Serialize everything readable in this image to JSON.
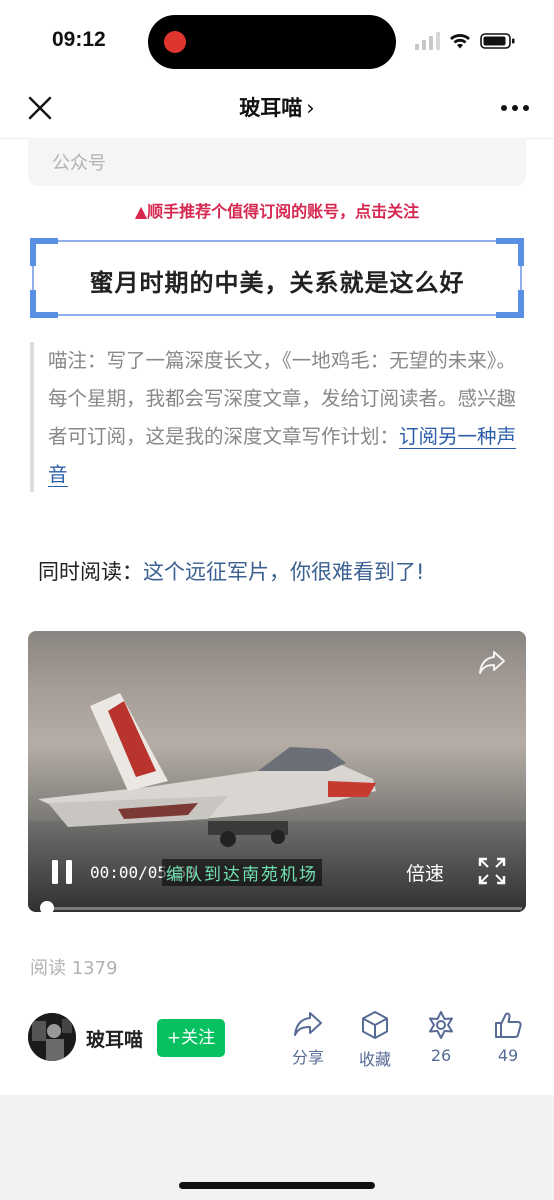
{
  "status_bar": {
    "time": "09:12"
  },
  "nav": {
    "title": "玻耳喵",
    "chevron": "›",
    "close_icon": "close-icon",
    "more_icon": "more-icon"
  },
  "article": {
    "account_box_label": "公众号",
    "recommend_text": "▲顺手推荐个值得订阅的账号，点击关注",
    "title": "蜜月时期的中美，关系就是这么好",
    "quote_text": "喵注：写了一篇深度长文，《一地鸡毛：无望的未来》。每个星期，我都会写深度文章，发给订阅读者。感兴趣者可订阅，这是我的深度文章写作计划：",
    "quote_link": "订阅另一种声音",
    "also_read_label": "同时阅读：",
    "also_read_link": "这个远征军片，你很难看到了!"
  },
  "video": {
    "time": "00:00/05:59",
    "subtitle": "编队到达南苑机场",
    "speed_label": "倍速",
    "progress": 0.0
  },
  "stats": {
    "read_count": "阅读 1379"
  },
  "footer": {
    "author_name": "玻耳喵",
    "follow_label": "+关注",
    "share_label": "分享",
    "favorite_label": "收藏",
    "wow_count": "26",
    "like_count": "49"
  },
  "colors": {
    "accent_green": "#07c160",
    "link_blue": "#576b95",
    "recommend_red": "#d6284f"
  }
}
